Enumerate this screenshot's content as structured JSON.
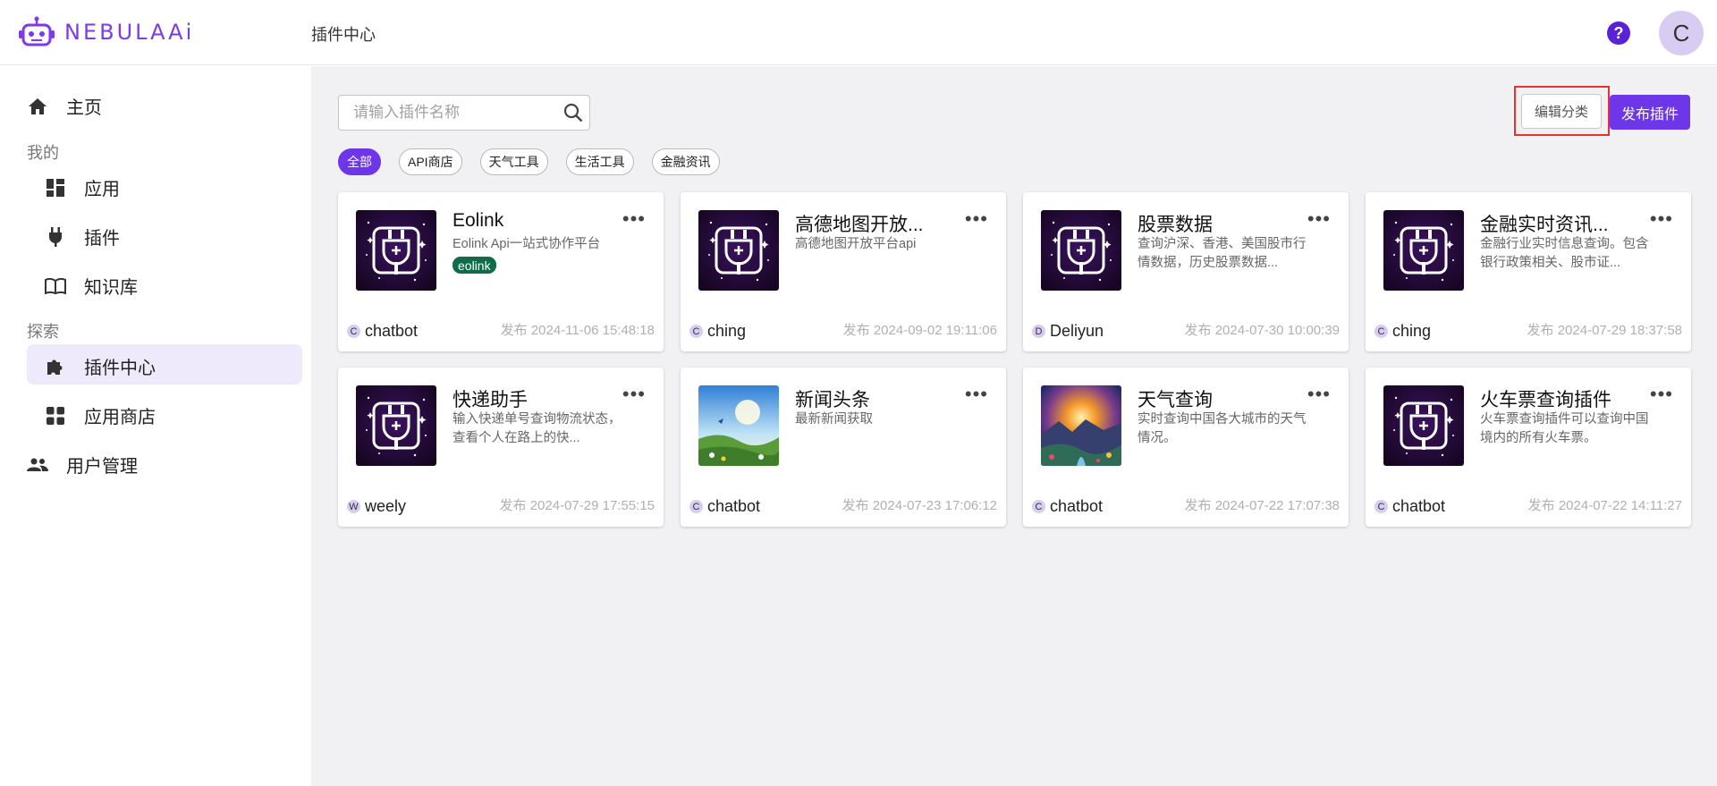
{
  "app": {
    "logo_text": "NEBULAAi",
    "page_title": "插件中心",
    "help_glyph": "?",
    "user_initial": "C"
  },
  "sidebar": {
    "home": "主页",
    "group_mine": "我的",
    "apps": "应用",
    "plugins": "插件",
    "knowledge": "知识库",
    "group_explore": "探索",
    "plugin_center": "插件中心",
    "app_store": "应用商店",
    "user_mgmt": "用户管理"
  },
  "search": {
    "placeholder": "请输入插件名称"
  },
  "toolbar": {
    "edit_category": "编辑分类",
    "publish_plugin": "发布插件"
  },
  "chips": [
    "全部",
    "API商店",
    "天气工具",
    "生活工具",
    "金融资讯"
  ],
  "cards": [
    {
      "title": "Eolink",
      "desc": "Eolink Api一站式协作平台",
      "tag": "eolink",
      "author_initial": "C",
      "author": "chatbot",
      "date": "发布 2024-11-06 15:48:18",
      "thumb": "plug"
    },
    {
      "title": "高德地图开放...",
      "desc": "高德地图开放平台api",
      "tag": "",
      "author_initial": "C",
      "author": "ching",
      "date": "发布 2024-09-02 19:11:06",
      "thumb": "plug"
    },
    {
      "title": "股票数据",
      "desc": "查询沪深、香港、美国股市行情数据，历史股票数据...",
      "tag": "",
      "author_initial": "D",
      "author": "Deliyun",
      "date": "发布 2024-07-30 10:00:39",
      "thumb": "plug"
    },
    {
      "title": "金融实时资讯...",
      "desc": "金融行业实时信息查询。包含银行政策相关、股市证...",
      "tag": "",
      "author_initial": "C",
      "author": "ching",
      "date": "发布 2024-07-29 18:37:58",
      "thumb": "plug"
    },
    {
      "title": "快递助手",
      "desc": "输入快递单号查询物流状态，查看个人在路上的快...",
      "tag": "",
      "author_initial": "W",
      "author": "weely",
      "date": "发布 2024-07-29 17:55:15",
      "thumb": "plug"
    },
    {
      "title": "新闻头条",
      "desc": "最新新闻获取",
      "tag": "",
      "author_initial": "C",
      "author": "chatbot",
      "date": "发布 2024-07-23 17:06:12",
      "thumb": "meadow"
    },
    {
      "title": "天气查询",
      "desc": "实时查询中国各大城市的天气情况。",
      "tag": "",
      "author_initial": "C",
      "author": "chatbot",
      "date": "发布 2024-07-22 17:07:38",
      "thumb": "sunset"
    },
    {
      "title": "火车票查询插件",
      "desc": "火车票查询插件可以查询中国境内的所有火车票。",
      "tag": "",
      "author_initial": "C",
      "author": "chatbot",
      "date": "发布 2024-07-22 14:11:27",
      "thumb": "plug"
    }
  ],
  "colors": {
    "accent": "#6d36e8",
    "logo": "#7c3aed",
    "highlight_box": "#e8322e",
    "tag_bg": "#0f6b4a"
  }
}
